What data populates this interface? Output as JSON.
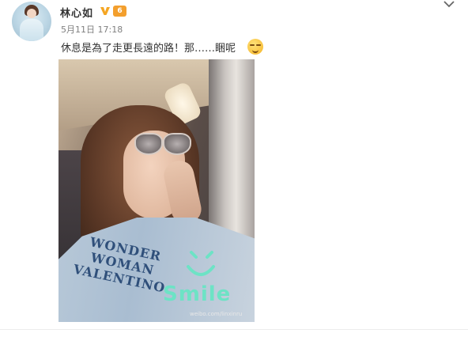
{
  "post": {
    "user_name": "林心如",
    "level_badge": "6",
    "timestamp": "5月11日 17:18",
    "text": "休息是為了走更長遠的路！那……睏呢",
    "emoji": "sleepy-face-emoji"
  },
  "photo": {
    "shirt_lines": [
      "WONDER",
      "WOMAN",
      "VALENTINO"
    ],
    "sticker_text": "Smile",
    "watermark": "weibo.com/linxinru"
  },
  "colors": {
    "name": "#333333",
    "meta": "#808080",
    "verified": "#f5a623",
    "level_badge": "#f39f2d",
    "sticker": "#6de3c5"
  },
  "icons": {
    "verified": "verified-v-icon",
    "level": "level-badge-icon",
    "more": "chevron-down-icon"
  }
}
